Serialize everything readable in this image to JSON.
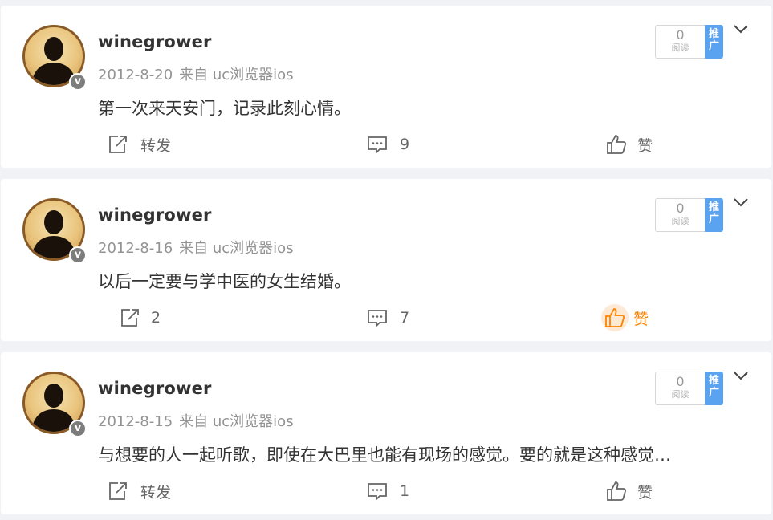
{
  "colors": {
    "background": "#f1f2f5",
    "card": "#ffffff",
    "text_primary": "#333333",
    "text_meta": "#939393",
    "promote_badge": "#5aa3f0",
    "liked_accent": "#ff8200",
    "liked_bg": "#fde9d4"
  },
  "posts": [
    {
      "username": "winegrower",
      "verified_badge": "v",
      "date": "2012-8-20",
      "source": "来自 uc浏览器ios",
      "text": "第一次来天安门，记录此刻心情。",
      "read_count": "0",
      "read_label": "阅读",
      "promote_label": "推广",
      "repost_label": "转发",
      "comment_count": "9",
      "like_label": "赞",
      "liked": false,
      "icons": [
        "avatar",
        "verified-icon",
        "chevron-down-icon",
        "repost-icon",
        "comment-icon",
        "thumbs-up-icon"
      ]
    },
    {
      "username": "winegrower",
      "verified_badge": "v",
      "date": "2012-8-16",
      "source": "来自 uc浏览器ios",
      "text": "以后一定要与学中医的女生结婚。",
      "read_count": "0",
      "read_label": "阅读",
      "promote_label": "推广",
      "repost_label": "2",
      "comment_count": "7",
      "like_label": "赞",
      "liked": true,
      "icons": [
        "avatar",
        "verified-icon",
        "chevron-down-icon",
        "repost-icon",
        "comment-icon",
        "thumbs-up-icon"
      ]
    },
    {
      "username": "winegrower",
      "verified_badge": "v",
      "date": "2012-8-15",
      "source": "来自 uc浏览器ios",
      "text": "与想要的人一起听歌，即使在大巴里也能有现场的感觉。要的就是这种感觉…",
      "read_count": "0",
      "read_label": "阅读",
      "promote_label": "推广",
      "repost_label": "转发",
      "comment_count": "1",
      "like_label": "赞",
      "liked": false,
      "icons": [
        "avatar",
        "verified-icon",
        "chevron-down-icon",
        "repost-icon",
        "comment-icon",
        "thumbs-up-icon"
      ]
    }
  ]
}
